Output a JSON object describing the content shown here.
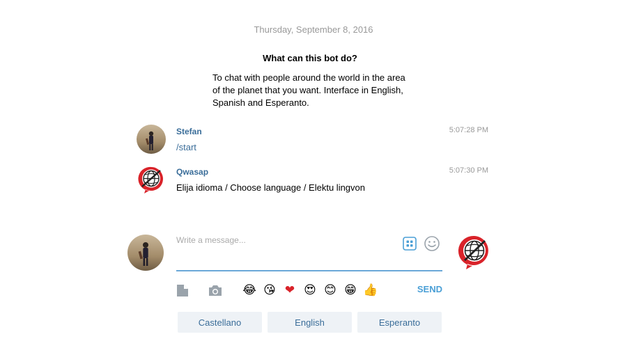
{
  "chat": {
    "date_separator": "Thursday, September 8, 2016",
    "bot_description": {
      "title": "What can this bot do?",
      "body": "To chat with people around the world in the area of the planet that you want. Interface in English, Spanish and Esperanto."
    },
    "messages": [
      {
        "author": "Stefan",
        "time": "5:07:28 PM",
        "text": "/start",
        "avatar": "user-photo-avatar"
      },
      {
        "author": "Qwasap",
        "time": "5:07:30 PM",
        "text": "Elija idioma / Choose language / Elektu lingvon",
        "avatar": "globe-bot-avatar"
      }
    ]
  },
  "composer": {
    "placeholder": "Write a message...",
    "value": "",
    "send_label": "SEND",
    "icons": [
      "bot-commands-icon",
      "emoji-icon",
      "file-icon",
      "camera-icon"
    ],
    "quick_emojis": [
      "😂",
      "😘",
      "❤",
      "😍",
      "😊",
      "😁",
      "👍"
    ]
  },
  "keyboard": {
    "buttons": [
      "Castellano",
      "English",
      "Esperanto"
    ]
  },
  "colors": {
    "link_blue": "#3a6d99",
    "accent_blue": "#4a9fd6",
    "input_underline": "#6aa8d8",
    "muted_text": "#999999",
    "keyboard_button_bg": "#eef2f6",
    "bot_logo_red": "#d9232a"
  }
}
